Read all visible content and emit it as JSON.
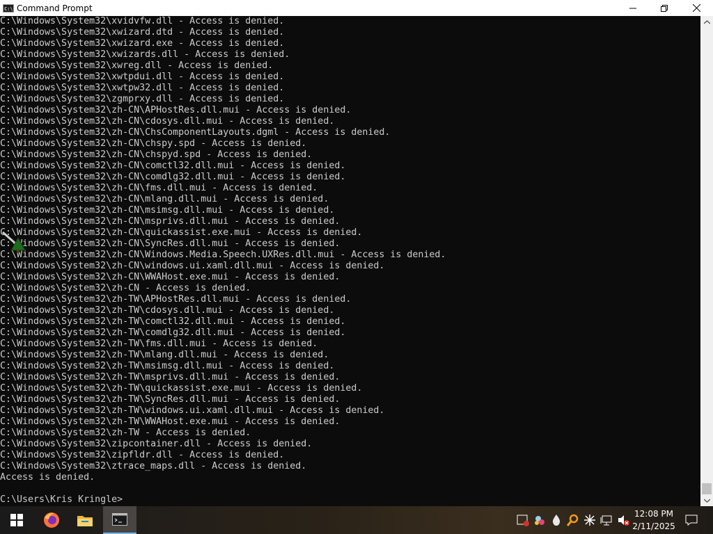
{
  "window": {
    "title": "Command Prompt"
  },
  "console": {
    "lines": [
      "C:\\Windows\\System32\\xvidvfw.dll - Access is denied.",
      "C:\\Windows\\System32\\xwizard.dtd - Access is denied.",
      "C:\\Windows\\System32\\xwizard.exe - Access is denied.",
      "C:\\Windows\\System32\\xwizards.dll - Access is denied.",
      "C:\\Windows\\System32\\xwreg.dll - Access is denied.",
      "C:\\Windows\\System32\\xwtpdui.dll - Access is denied.",
      "C:\\Windows\\System32\\xwtpw32.dll - Access is denied.",
      "C:\\Windows\\System32\\zgmprxy.dll - Access is denied.",
      "C:\\Windows\\System32\\zh-CN\\APHostRes.dll.mui - Access is denied.",
      "C:\\Windows\\System32\\zh-CN\\cdosys.dll.mui - Access is denied.",
      "C:\\Windows\\System32\\zh-CN\\ChsComponentLayouts.dgml - Access is denied.",
      "C:\\Windows\\System32\\zh-CN\\chspy.spd - Access is denied.",
      "C:\\Windows\\System32\\zh-CN\\chspyd.spd - Access is denied.",
      "C:\\Windows\\System32\\zh-CN\\comctl32.dll.mui - Access is denied.",
      "C:\\Windows\\System32\\zh-CN\\comdlg32.dll.mui - Access is denied.",
      "C:\\Windows\\System32\\zh-CN\\fms.dll.mui - Access is denied.",
      "C:\\Windows\\System32\\zh-CN\\mlang.dll.mui - Access is denied.",
      "C:\\Windows\\System32\\zh-CN\\msimsg.dll.mui - Access is denied.",
      "C:\\Windows\\System32\\zh-CN\\msprivs.dll.mui - Access is denied.",
      "C:\\Windows\\System32\\zh-CN\\quickassist.exe.mui - Access is denied.",
      "C:\\Windows\\System32\\zh-CN\\SyncRes.dll.mui - Access is denied.",
      "C:\\Windows\\System32\\zh-CN\\Windows.Media.Speech.UXRes.dll.mui - Access is denied.",
      "C:\\Windows\\System32\\zh-CN\\windows.ui.xaml.dll.mui - Access is denied.",
      "C:\\Windows\\System32\\zh-CN\\WWAHost.exe.mui - Access is denied.",
      "C:\\Windows\\System32\\zh-CN - Access is denied.",
      "C:\\Windows\\System32\\zh-TW\\APHostRes.dll.mui - Access is denied.",
      "C:\\Windows\\System32\\zh-TW\\cdosys.dll.mui - Access is denied.",
      "C:\\Windows\\System32\\zh-TW\\comctl32.dll.mui - Access is denied.",
      "C:\\Windows\\System32\\zh-TW\\comdlg32.dll.mui - Access is denied.",
      "C:\\Windows\\System32\\zh-TW\\fms.dll.mui - Access is denied.",
      "C:\\Windows\\System32\\zh-TW\\mlang.dll.mui - Access is denied.",
      "C:\\Windows\\System32\\zh-TW\\msimsg.dll.mui - Access is denied.",
      "C:\\Windows\\System32\\zh-TW\\msprivs.dll.mui - Access is denied.",
      "C:\\Windows\\System32\\zh-TW\\quickassist.exe.mui - Access is denied.",
      "C:\\Windows\\System32\\zh-TW\\SyncRes.dll.mui - Access is denied.",
      "C:\\Windows\\System32\\zh-TW\\windows.ui.xaml.dll.mui - Access is denied.",
      "C:\\Windows\\System32\\zh-TW\\WWAHost.exe.mui - Access is denied.",
      "C:\\Windows\\System32\\zh-TW - Access is denied.",
      "C:\\Windows\\System32\\zipcontainer.dll - Access is denied.",
      "C:\\Windows\\System32\\zipfldr.dll - Access is denied.",
      "C:\\Windows\\System32\\ztrace_maps.dll - Access is denied.",
      "Access is denied.",
      "",
      "C:\\Users\\Kris Kringle>"
    ]
  },
  "taskbar": {
    "apps": [
      {
        "name": "start-button"
      },
      {
        "name": "firefox"
      },
      {
        "name": "file-explorer"
      },
      {
        "name": "command-prompt"
      }
    ],
    "clock": {
      "time": "12:08 PM",
      "date": "2/11/2025"
    }
  },
  "colors": {
    "console_bg": "#0c0c0c",
    "console_text": "#cccccc",
    "titlebar_bg": "#ffffff",
    "taskbar_active_underline": "#76b9ed"
  }
}
